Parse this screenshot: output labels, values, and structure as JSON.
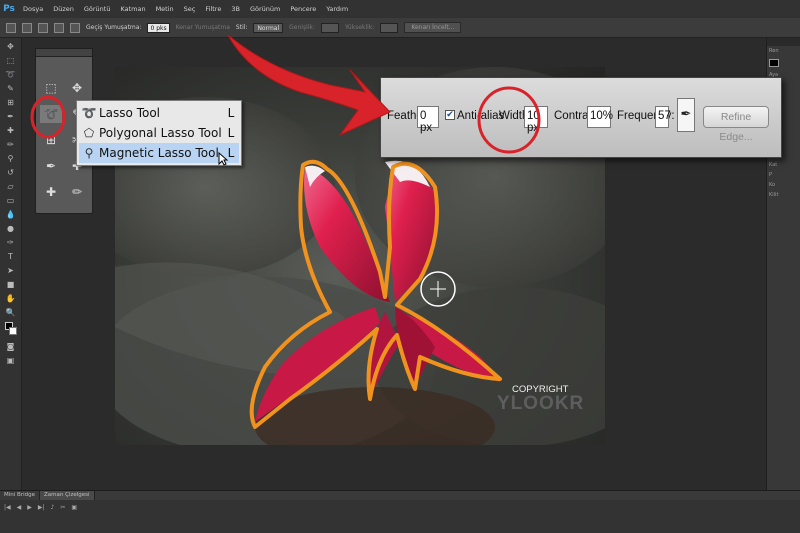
{
  "app": {
    "logo": "Ps"
  },
  "menubar": {
    "items": [
      "Dosya",
      "Düzen",
      "Görüntü",
      "Katman",
      "Metin",
      "Seç",
      "Filtre",
      "3B",
      "Görünüm",
      "Pencere",
      "Yardım"
    ]
  },
  "options_bar": {
    "feather_label": "Geçiş Yumuşatma:",
    "feather_value": "0 pks",
    "antialias_label": "Kenar Yumuşatma",
    "style_label": "Stil:",
    "style_value": "Normal",
    "width_label": "Genişlik:",
    "height_label": "Yükseklik:",
    "refine_label": "Kenarı İncelt..."
  },
  "lasso_menu": {
    "items": [
      {
        "label": "Lasso Tool",
        "shortcut": "L",
        "icon": "lasso-icon"
      },
      {
        "label": "Polygonal Lasso Tool",
        "shortcut": "L",
        "icon": "polygonal-lasso-icon"
      },
      {
        "label": "Magnetic Lasso Tool",
        "shortcut": "L",
        "icon": "magnetic-lasso-icon",
        "selected": true
      }
    ]
  },
  "callout": {
    "feather_label": "Feather:",
    "feather_value": "0 px",
    "antialias_label": "Anti-alias",
    "width_label": "Width:",
    "width_value": "10 px",
    "contrast_label": "Contrast:",
    "contrast_value": "10%",
    "frequency_label": "Frequency:",
    "frequency_value": "57",
    "refine_label": "Refine Edge..."
  },
  "bottom_tabs": [
    "Mini Bridge",
    "Zaman Çizelgesi"
  ],
  "right_panel": {
    "labels": [
      "Ren",
      "Aya",
      "Ayı",
      "Kat",
      "P",
      "Ko",
      "Kilit"
    ]
  },
  "image": {
    "copyright": "COPYRIGHT",
    "watermark": "YLOOKR"
  },
  "colors": {
    "annotation_red": "#d9232a",
    "selection_orange": "#f0921e",
    "flower_pink": "#d81e50",
    "ui_dark": "#2b2b2b"
  }
}
